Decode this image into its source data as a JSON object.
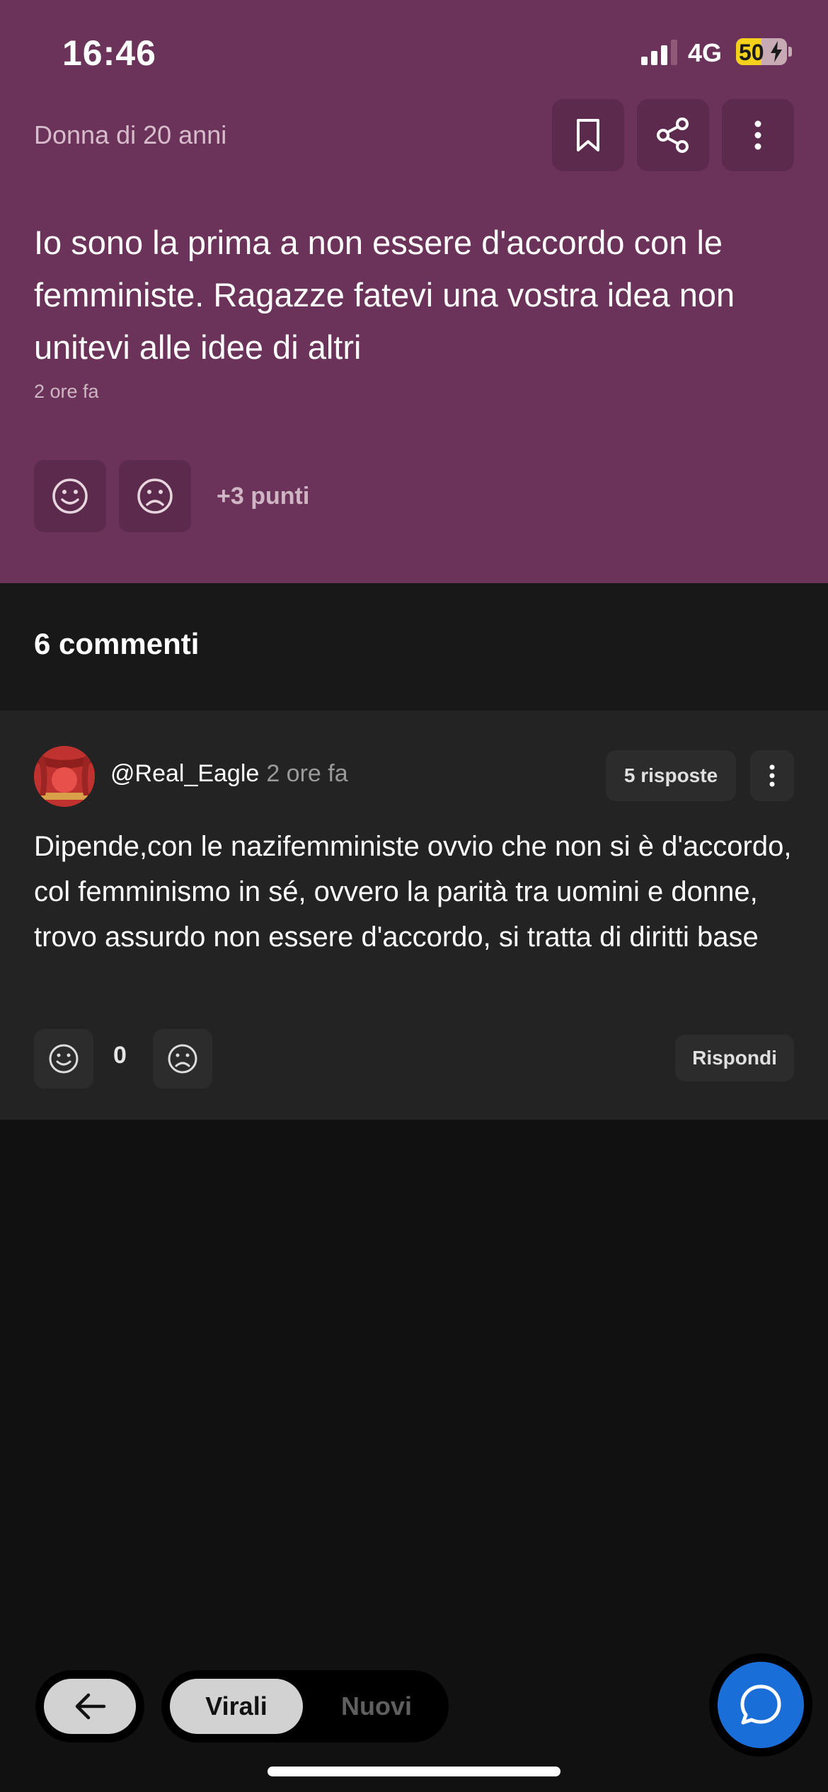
{
  "status_bar": {
    "time": "16:46",
    "network": "4G",
    "battery": "50",
    "battery_level": 0.5
  },
  "post": {
    "author_meta": "Donna di 20 anni",
    "text": "Io sono la prima a non essere d'accordo con le femministe. Ragazze fatevi una vostra idea non unitevi alle idee di altri",
    "time": "2 ore fa",
    "points": "+3 punti",
    "actions": [
      "bookmark-icon",
      "share-icon",
      "more-icon"
    ],
    "background": "#6b3359"
  },
  "comments": {
    "title": "6 commenti",
    "items": [
      {
        "user": "@Real_Eagle",
        "time": "2 ore fa",
        "replies": "5 risposte",
        "text": "Dipende,con le nazifemministe ovvio che non si è d'accordo, col femminismo in sé, ovvero la parità tra uomini e donne, trovo assurdo non essere d'accordo, si tratta di diritti base",
        "score": "0",
        "reply_label": "Rispondi"
      }
    ]
  },
  "bottom_bar": {
    "sort_active": "Virali",
    "sort_inactive": "Nuovi",
    "accent": "#1a6ed8"
  }
}
